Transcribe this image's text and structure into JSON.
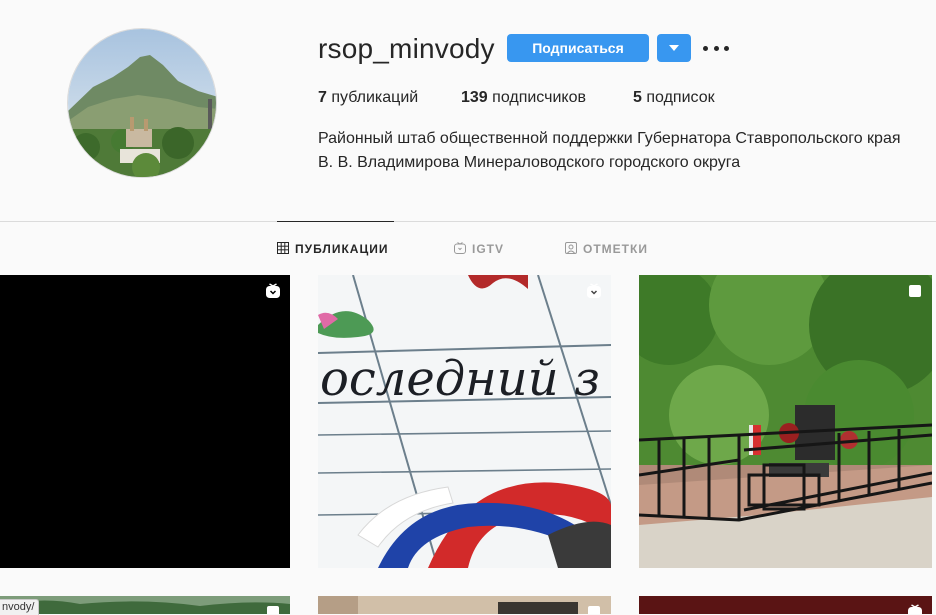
{
  "profile": {
    "username": "rsop_minvody",
    "follow_label": "Подписаться",
    "stats": {
      "posts_count": "7",
      "posts_label": "публикаций",
      "followers_count": "139",
      "followers_label": "подписчиков",
      "following_count": "5",
      "following_label": "подписок"
    },
    "bio": [
      "Районный штаб общественной поддержки Губернатора Ставропольского края",
      "В. В. Владимирова Минераловодского городского округа"
    ]
  },
  "tabs": [
    {
      "label": "ПУБЛИКАЦИИ",
      "icon": "grid-icon",
      "active": true
    },
    {
      "label": "IGTV",
      "icon": "igtv-icon",
      "active": false
    },
    {
      "label": "ОТМЕТКИ",
      "icon": "tagged-icon",
      "active": false
    }
  ],
  "posts": [
    {
      "kind": "igtv",
      "content": "black video",
      "icon": "igtv-icon"
    },
    {
      "kind": "igtv",
      "content": "handwritten card with tricolor ribbon",
      "icon": "igtv-icon",
      "image_text": "оследний з"
    },
    {
      "kind": "carousel",
      "content": "memorial with fence and flags",
      "icon": "carousel-icon"
    },
    {
      "kind": "carousel",
      "content": "green hills",
      "icon": "carousel-icon"
    },
    {
      "kind": "carousel",
      "content": "indoor room",
      "icon": "carousel-icon"
    },
    {
      "kind": "igtv",
      "content": "dark red",
      "icon": "igtv-icon"
    }
  ],
  "status_bar": {
    "url_fragment": "nvody/"
  },
  "colors": {
    "accent": "#3897f0",
    "background": "#fafafa",
    "divider": "#dbdbdb",
    "text": "#262626",
    "muted": "#999999"
  }
}
